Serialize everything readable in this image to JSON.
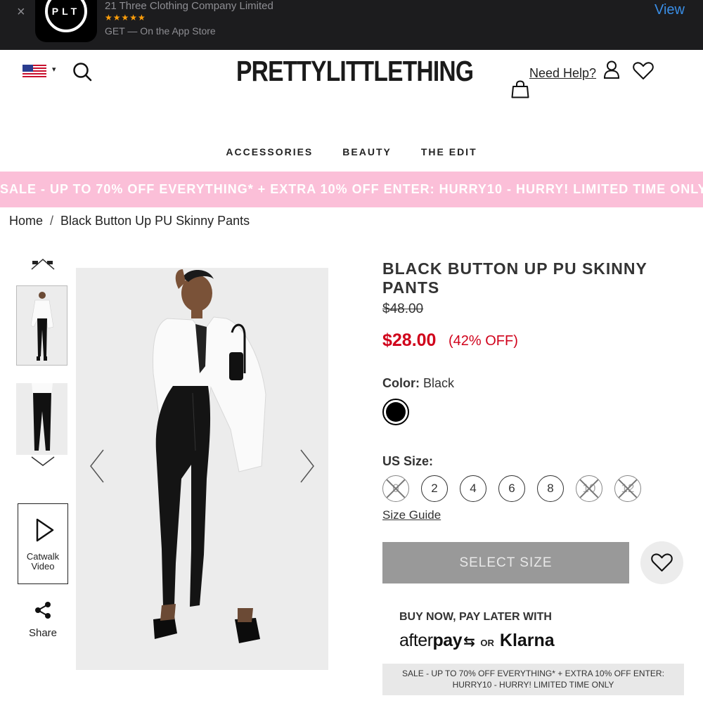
{
  "app_banner": {
    "close_glyph": "×",
    "icon_text": "PLT",
    "app_name": "21 Three Clothing Company Limited",
    "stars": "★★★★★",
    "store_text": "GET — On the App Store",
    "view_label": "View"
  },
  "header": {
    "logo": "PRETTYLITTLETHING",
    "need_help": "Need Help?",
    "country_chevron": "▾"
  },
  "nav": {
    "items": [
      {
        "label": "ACCESSORIES"
      },
      {
        "label": "BEAUTY"
      },
      {
        "label": "THE EDIT"
      }
    ]
  },
  "promo": {
    "text": "SALE - UP TO 70% OFF EVERYTHING* + EXTRA 10% OFF ENTER: HURRY10 - HURRY! LIMITED TIME ONLY"
  },
  "breadcrumb": {
    "home": "Home",
    "separator": "/",
    "current": "Black Button Up PU Skinny Pants"
  },
  "gallery": {
    "catwalk_line1": "Catwalk",
    "catwalk_line2": "Video",
    "share_label": "Share"
  },
  "product": {
    "title": "BLACK BUTTON UP PU SKINNY PANTS",
    "old_price": "$48.00",
    "new_price": "$28.00",
    "discount": "(42% OFF)",
    "color_label": "Color:",
    "color_value": "Black",
    "size_label": "US Size:",
    "sizes": [
      {
        "label": "0",
        "available": false
      },
      {
        "label": "2",
        "available": true
      },
      {
        "label": "4",
        "available": true
      },
      {
        "label": "6",
        "available": true
      },
      {
        "label": "8",
        "available": true
      },
      {
        "label": "10",
        "available": false
      },
      {
        "label": "12",
        "available": false
      }
    ],
    "size_guide": "Size Guide",
    "select_size": "SELECT SIZE",
    "bnpl_heading": "BUY NOW, PAY LATER WITH",
    "afterpay_a": "after",
    "afterpay_b": "pay",
    "afterpay_mark": "⇆",
    "or": "OR",
    "klarna": "Klarna",
    "sale_note_line1": "SALE - UP TO 70% OFF EVERYTHING* + EXTRA 10% OFF ENTER:",
    "sale_note_line2": "HURRY10 - HURRY! LIMITED TIME ONLY"
  },
  "colors": {
    "promo_bg": "#fbbfd8",
    "price_red": "#d0021b",
    "button_disabled": "#999999"
  }
}
